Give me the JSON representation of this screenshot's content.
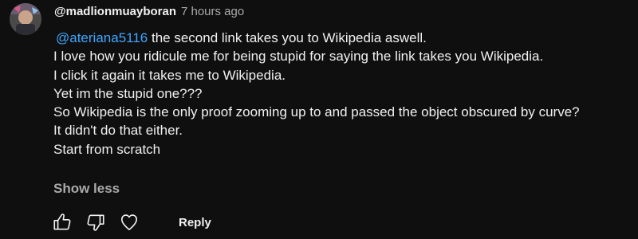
{
  "comment": {
    "author": "@madlionmuayboran",
    "timestamp": "7 hours ago",
    "mention": "@ateriana5116",
    "first_line_rest": " the second link takes you to Wikipedia aswell.",
    "lines": [
      "I love how you ridicule me for being stupid for saying the link takes you Wikipedia.",
      "I click it again it takes me to Wikipedia.",
      "Yet im the stupid one???",
      "So Wikipedia is the only proof zooming up to and passed the object obscured by curve?",
      "It didn't do that either.",
      "Start from scratch"
    ],
    "show_less_label": "Show less",
    "reply_label": "Reply"
  },
  "icons": {
    "avatar": "avatar-image",
    "like": "thumbs-up-icon",
    "dislike": "thumbs-down-icon",
    "heart": "heart-icon"
  },
  "colors": {
    "background": "#0f0f0f",
    "text": "#f1f1f1",
    "secondary_text": "#aaaaaa",
    "mention": "#3ea6ff"
  }
}
